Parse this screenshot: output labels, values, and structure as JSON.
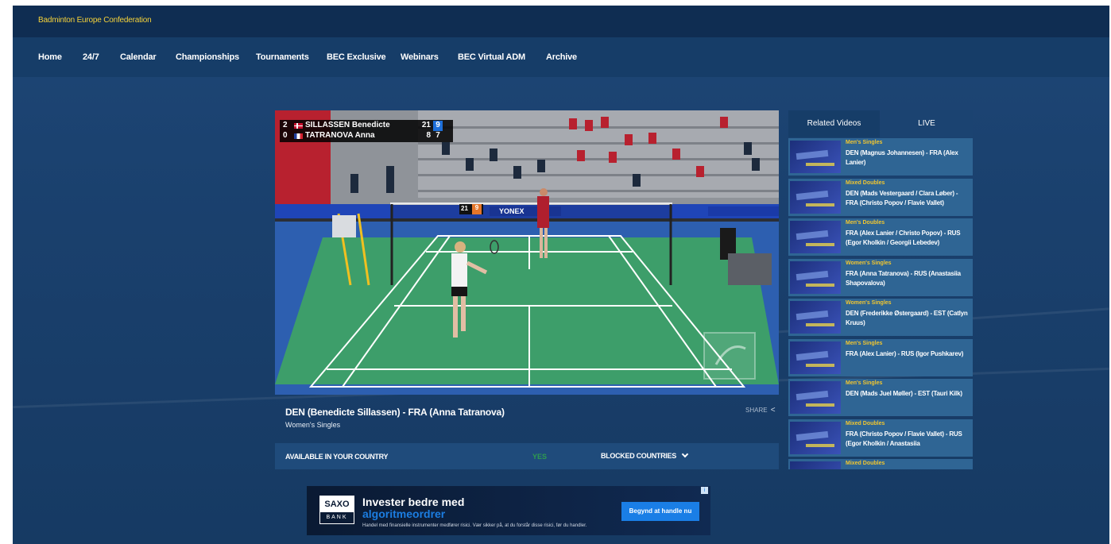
{
  "header": {
    "brand": "Badminton Europe Confederation"
  },
  "nav": {
    "items": [
      "Home",
      "24/7",
      "Calendar",
      "Championships",
      "Tournaments",
      "BEC Exclusive",
      "Webinars",
      "BEC Virtual ADM",
      "Archive"
    ]
  },
  "player": {
    "scoreboard": {
      "rows": [
        {
          "sets": "2",
          "name": "SILLASSEN Benedicte",
          "game1": "21",
          "game2": "9",
          "flag": "denmark"
        },
        {
          "sets": "0",
          "name": "TATRANOVA Anna",
          "game1": "8",
          "game2": "7",
          "flag": "france"
        }
      ]
    },
    "court_board": {
      "score_left": "21",
      "score_right": "9",
      "sponsor": "YONEX"
    }
  },
  "video": {
    "title": "DEN (Benedicte Sillassen) - FRA (Anna Tatranova)",
    "category": "Women's Singles",
    "share_label": "SHARE",
    "availability_label": "AVAILABLE IN YOUR COUNTRY",
    "availability_value": "YES",
    "blocked_label": "BLOCKED COUNTRIES"
  },
  "related": {
    "tabs": [
      {
        "label": "Related Videos",
        "active": true
      },
      {
        "label": "LIVE",
        "active": false
      }
    ],
    "items": [
      {
        "category": "Men's Singles",
        "title": "DEN (Magnus Johannesen) - FRA (Alex Lanier)"
      },
      {
        "category": "Mixed Doubles",
        "title": "DEN (Mads Vestergaard / Clara Løber) - FRA (Christo Popov / Flavie Vallet)"
      },
      {
        "category": "Men's Doubles",
        "title": "FRA (Alex Lanier / Christo Popov) - RUS (Egor Kholkin / Georgii Lebedev)"
      },
      {
        "category": "Women's Singles",
        "title": "FRA (Anna Tatranova) - RUS (Anastasiia Shapovalova)"
      },
      {
        "category": "Women's Singles",
        "title": "DEN (Frederikke Østergaard) - EST (Catlyn Kruus)"
      },
      {
        "category": "Men's Singles",
        "title": "FRA (Alex Lanier) - RUS (Igor Pushkarev)"
      },
      {
        "category": "Men's Singles",
        "title": "DEN (Mads Juel Møller) - EST (Tauri Kilk)"
      },
      {
        "category": "Mixed Doubles",
        "title": "FRA (Christo Popov / Flavie Vallet) - RUS (Egor Kholkin / Anastasiia"
      },
      {
        "category": "Mixed Doubles",
        "title": ""
      }
    ]
  },
  "ad": {
    "logo_top": "SAXO",
    "logo_bottom": "BANK",
    "headline": "Invester bedre med",
    "subheadline": "algoritmeordrer",
    "disclaimer": "Handel med finansielle instrumenter medfører risici. Vær sikker på, at du forstår disse risici, før du handler.",
    "cta": "Begynd at handle nu",
    "info": "i"
  },
  "colors": {
    "brand_yellow": "#f5d23a",
    "nav_bg": "#163d68",
    "card_bg": "#2f6594",
    "accent_blue": "#1a7ee6",
    "yes_green": "#2e9b4f"
  }
}
